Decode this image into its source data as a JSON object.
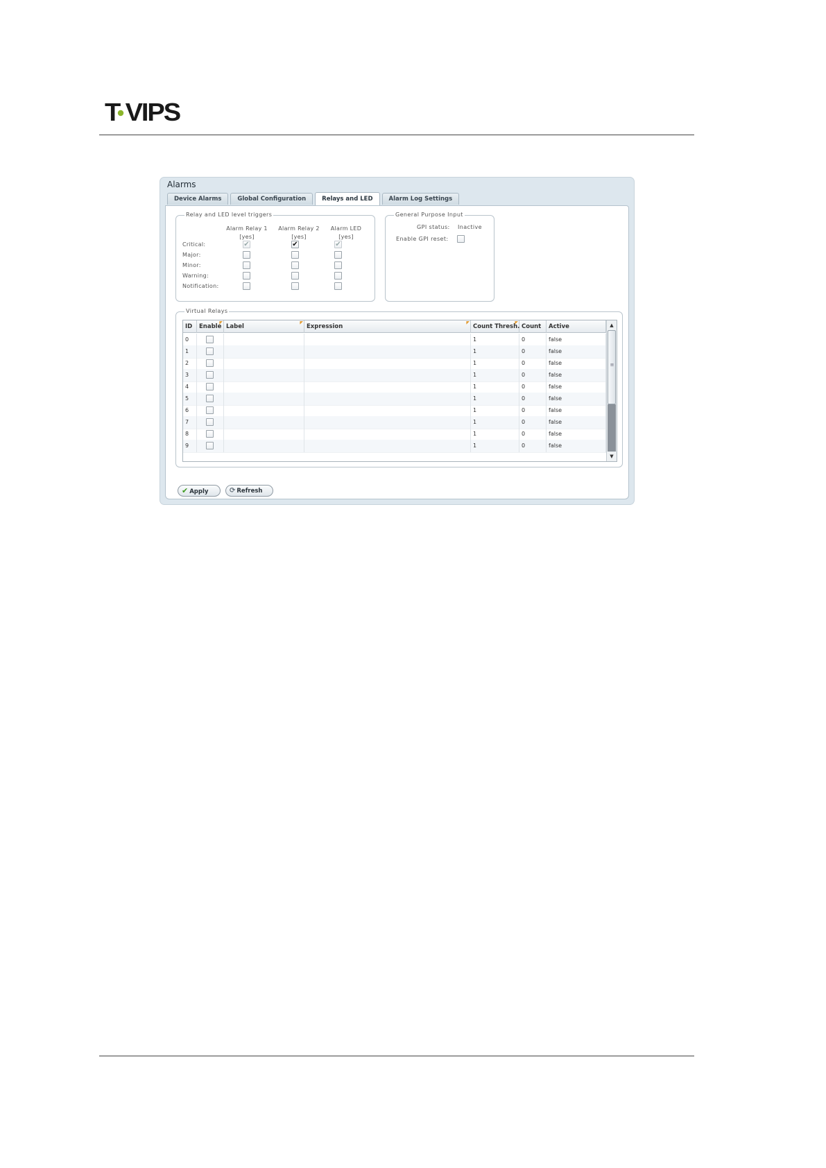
{
  "brand": {
    "logo_text": "T-VIPS",
    "logo_dot_color": "#8bb52b"
  },
  "panel": {
    "title": "Alarms",
    "tabs": [
      {
        "label": "Device Alarms",
        "active": false
      },
      {
        "label": "Global Configuration",
        "active": false
      },
      {
        "label": "Relays and LED",
        "active": true
      },
      {
        "label": "Alarm Log Settings",
        "active": false
      }
    ]
  },
  "relay_triggers": {
    "legend": "Relay and LED level triggers",
    "columns": [
      {
        "line1": "Alarm Relay 1",
        "line2": "[yes]"
      },
      {
        "line1": "Alarm Relay 2",
        "line2": "[yes]"
      },
      {
        "line1": "Alarm LED",
        "line2": "[yes]"
      }
    ],
    "rows": [
      {
        "label": "Critical:",
        "values": [
          {
            "checked": true,
            "disabled": true
          },
          {
            "checked": true,
            "disabled": false
          },
          {
            "checked": true,
            "disabled": true
          }
        ]
      },
      {
        "label": "Major:",
        "values": [
          {
            "checked": false,
            "disabled": false
          },
          {
            "checked": false,
            "disabled": false
          },
          {
            "checked": false,
            "disabled": false
          }
        ]
      },
      {
        "label": "Minor:",
        "values": [
          {
            "checked": false,
            "disabled": false
          },
          {
            "checked": false,
            "disabled": false
          },
          {
            "checked": false,
            "disabled": false
          }
        ]
      },
      {
        "label": "Warning:",
        "values": [
          {
            "checked": false,
            "disabled": false
          },
          {
            "checked": false,
            "disabled": false
          },
          {
            "checked": false,
            "disabled": false
          }
        ]
      },
      {
        "label": "Notification:",
        "values": [
          {
            "checked": false,
            "disabled": false
          },
          {
            "checked": false,
            "disabled": false
          },
          {
            "checked": false,
            "disabled": false
          }
        ]
      }
    ]
  },
  "gpi": {
    "legend": "General Purpose Input",
    "status_label": "GPI status:",
    "status_value": "Inactive",
    "reset_label": "Enable GPI reset:",
    "reset_checked": false
  },
  "virtual_relays": {
    "legend": "Virtual Relays",
    "columns": [
      {
        "key": "id",
        "label": "ID",
        "editable": false
      },
      {
        "key": "enable",
        "label": "Enable",
        "editable": true
      },
      {
        "key": "label",
        "label": "Label",
        "editable": true
      },
      {
        "key": "expression",
        "label": "Expression",
        "editable": true
      },
      {
        "key": "count_thresh",
        "label": "Count Thresh.",
        "editable": true
      },
      {
        "key": "count",
        "label": "Count",
        "editable": false
      },
      {
        "key": "active",
        "label": "Active",
        "editable": false
      }
    ],
    "rows": [
      {
        "id": "0",
        "enable": false,
        "label": "",
        "expression": "",
        "count_thresh": "1",
        "count": "0",
        "active": "false"
      },
      {
        "id": "1",
        "enable": false,
        "label": "",
        "expression": "",
        "count_thresh": "1",
        "count": "0",
        "active": "false"
      },
      {
        "id": "2",
        "enable": false,
        "label": "",
        "expression": "",
        "count_thresh": "1",
        "count": "0",
        "active": "false"
      },
      {
        "id": "3",
        "enable": false,
        "label": "",
        "expression": "",
        "count_thresh": "1",
        "count": "0",
        "active": "false"
      },
      {
        "id": "4",
        "enable": false,
        "label": "",
        "expression": "",
        "count_thresh": "1",
        "count": "0",
        "active": "false"
      },
      {
        "id": "5",
        "enable": false,
        "label": "",
        "expression": "",
        "count_thresh": "1",
        "count": "0",
        "active": "false"
      },
      {
        "id": "6",
        "enable": false,
        "label": "",
        "expression": "",
        "count_thresh": "1",
        "count": "0",
        "active": "false"
      },
      {
        "id": "7",
        "enable": false,
        "label": "",
        "expression": "",
        "count_thresh": "1",
        "count": "0",
        "active": "false"
      },
      {
        "id": "8",
        "enable": false,
        "label": "",
        "expression": "",
        "count_thresh": "1",
        "count": "0",
        "active": "false"
      },
      {
        "id": "9",
        "enable": false,
        "label": "",
        "expression": "",
        "count_thresh": "1",
        "count": "0",
        "active": "false"
      }
    ]
  },
  "buttons": {
    "apply": "Apply",
    "refresh": "Refresh"
  },
  "icons": {
    "apply": "checkmark-icon",
    "refresh": "refresh-icon",
    "scroll_up": "arrow-up-icon",
    "scroll_down": "arrow-down-icon"
  }
}
